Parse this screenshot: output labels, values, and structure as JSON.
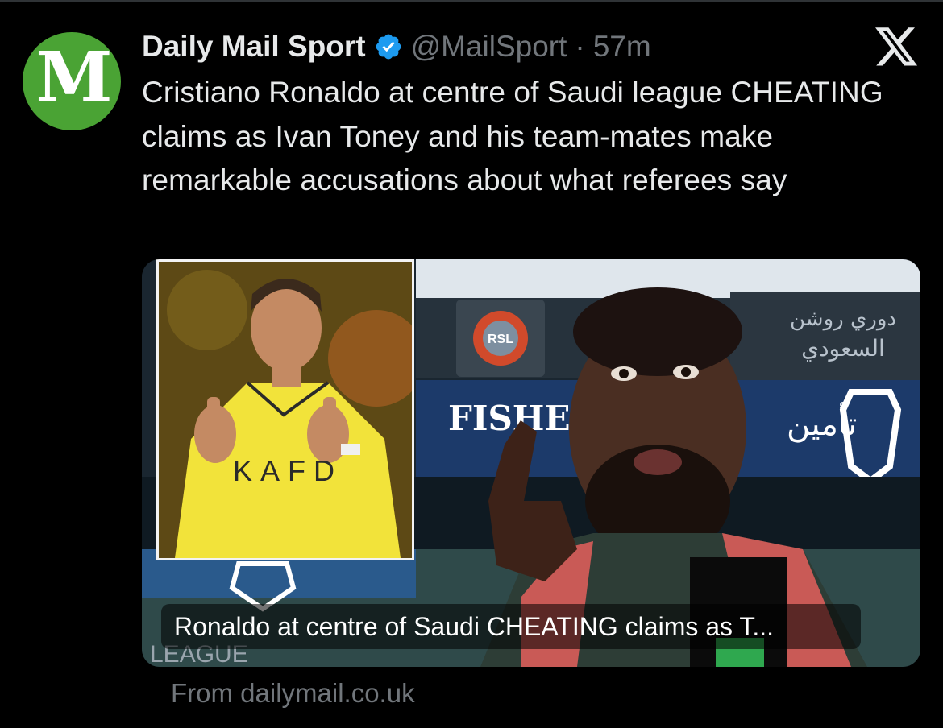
{
  "account": {
    "avatar_letter": "M",
    "display_name": "Daily Mail Sport",
    "handle": "@MailSport",
    "separator": "·",
    "timestamp": "57m",
    "avatar_color": "#4aa334",
    "verified_color": "#1d9bf0"
  },
  "tweet": {
    "text": "Cristiano Ronaldo at centre of Saudi league CHEATING claims as Ivan Toney and his team-mates make remarkable accusations about what referees say"
  },
  "card": {
    "title": "Ronaldo at centre of Saudi CHEATING claims as T...",
    "source": "From dailymail.co.uk",
    "shirt_sponsor": "KAFD",
    "board_sponsor": "FISHER",
    "board_badge": "RSL",
    "board_arabic_1": "دوري روشن",
    "board_arabic_2": "السعودي",
    "board_arabic_3": "تأمين",
    "board_partial_left": "LEAGUE"
  },
  "icons": {
    "brand": "x-logo-icon",
    "verified": "verified-badge-icon"
  }
}
